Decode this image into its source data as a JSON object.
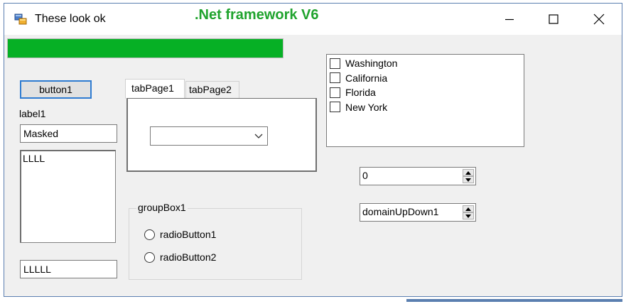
{
  "window": {
    "title": "These look ok",
    "overlay_text": ".Net framework V6",
    "overlay_color": "#1fa32d",
    "controls": {
      "minimize": "minimize-icon",
      "maximize": "maximize-icon",
      "close": "close-icon"
    }
  },
  "progress": {
    "value_fraction": 1.0,
    "color": "#06b025"
  },
  "button1": {
    "label": "button1"
  },
  "label1": {
    "text": "label1"
  },
  "masked_textbox": {
    "value": "Masked"
  },
  "listbox": {
    "items": [
      "LLLL"
    ]
  },
  "bottom_textbox": {
    "value": "LLLLL"
  },
  "tabs": [
    {
      "label": "tabPage1",
      "selected": true
    },
    {
      "label": "tabPage2",
      "selected": false
    }
  ],
  "combobox": {
    "value": ""
  },
  "groupbox": {
    "label": "groupBox1",
    "radios": [
      {
        "label": "radioButton1",
        "checked": false
      },
      {
        "label": "radioButton2",
        "checked": false
      }
    ]
  },
  "checklist": {
    "items": [
      {
        "label": "Washington",
        "checked": false
      },
      {
        "label": "California",
        "checked": false
      },
      {
        "label": "Florida",
        "checked": false
      },
      {
        "label": "New York",
        "checked": false
      }
    ]
  },
  "numeric_updown": {
    "value": "0"
  },
  "domain_updown": {
    "value": "domainUpDown1"
  }
}
